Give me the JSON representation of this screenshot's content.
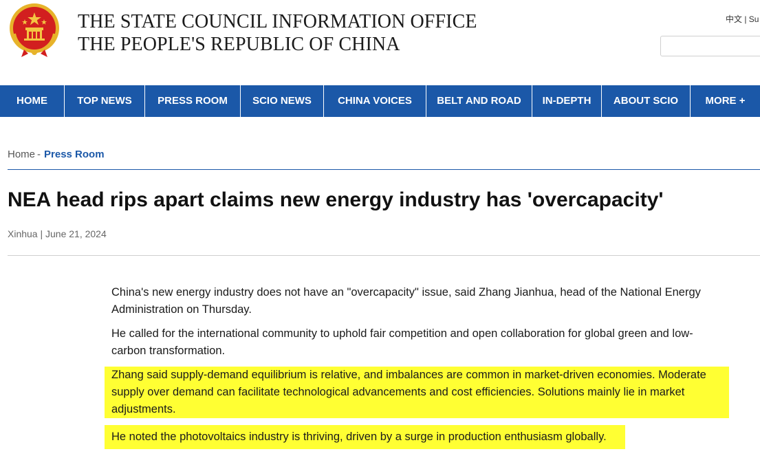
{
  "header": {
    "title_line1": "THE STATE COUNCIL INFORMATION OFFICE",
    "title_line2": "THE PEOPLE'S REPUBLIC OF CHINA",
    "lang_links": "中文 | Su",
    "search_placeholder": ""
  },
  "nav": {
    "items": [
      "HOME",
      "TOP NEWS",
      "PRESS ROOM",
      "SCIO NEWS",
      "CHINA VOICES",
      "BELT AND ROAD",
      "IN-DEPTH",
      "ABOUT SCIO",
      "MORE +"
    ]
  },
  "breadcrumb": {
    "home": "Home",
    "sep": "-",
    "current": "Press Room"
  },
  "article": {
    "headline": "NEA head rips apart claims new energy industry has 'overcapacity'",
    "byline": "Xinhua | June 21, 2024",
    "paragraphs": [
      "China's new energy industry does not have an \"overcapacity\" issue, said Zhang Jianhua, head of the National Energy Administration on Thursday.",
      "He called for the international community to uphold fair competition and open collaboration for global green and low-carbon transformation.",
      "Zhang said supply-demand equilibrium is relative, and imbalances are common in market-driven economies. Moderate supply over demand can facilitate technological advancements and cost efficiencies. Solutions mainly lie in market adjustments.",
      "He noted the photovoltaics industry is thriving, driven by a surge in production enthusiasm globally."
    ],
    "highlight_color": "#ffff33"
  },
  "colors": {
    "nav_bg": "#1b58a8",
    "link": "#1b58a8",
    "emblem_red": "#d21f1f",
    "emblem_gold": "#e7b32a"
  }
}
